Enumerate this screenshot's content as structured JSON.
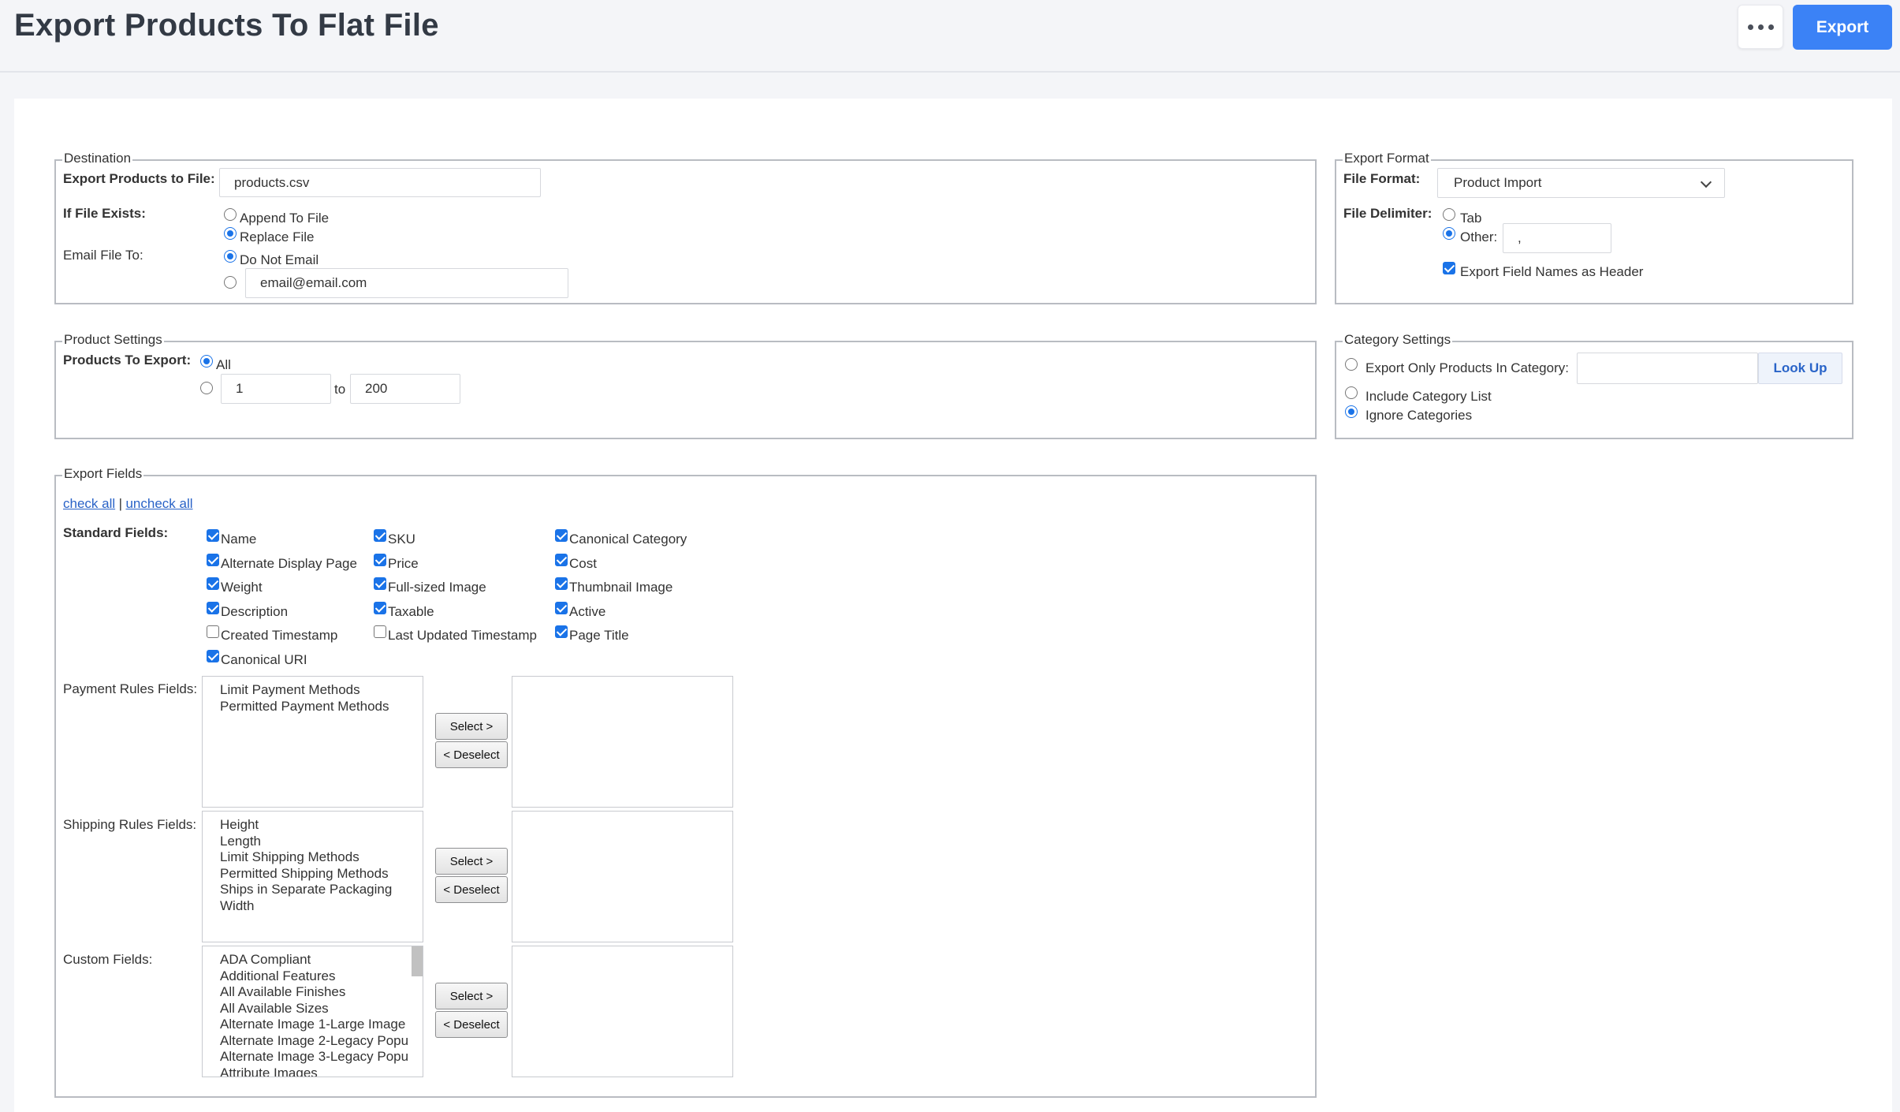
{
  "header": {
    "title": "Export Products To Flat File",
    "export_label": "Export",
    "more_icon": "more-horizontal-icon"
  },
  "destination": {
    "legend": "Destination",
    "file_label": "Export Products to File:",
    "file_value": "products.csv",
    "if_exists_label": "If File Exists:",
    "append_label": "Append To File",
    "replace_label": "Replace File",
    "if_exists_selected": "Replace File",
    "email_label": "Email File To:",
    "no_email_label": "Do Not Email",
    "email_selected": "Do Not Email",
    "email_value": "email@email.com"
  },
  "export_format": {
    "legend": "Export Format",
    "file_format_label": "File Format:",
    "file_format_value": "Product Import",
    "delimiter_label": "File Delimiter:",
    "tab_label": "Tab",
    "other_label": "Other:",
    "delimiter_selected": "Other:",
    "other_value": ",",
    "header_label": "Export Field Names as Header",
    "header_checked": true
  },
  "product_settings": {
    "legend": "Product Settings",
    "products_label": "Products To Export:",
    "all_label": "All",
    "selected": "All",
    "range_from": "1",
    "range_to_label": "to",
    "range_to": "200"
  },
  "category_settings": {
    "legend": "Category Settings",
    "only_in_category_label": "Export Only Products In Category:",
    "category_value": "",
    "lookup_label": "Look Up",
    "include_list_label": "Include Category List",
    "ignore_label": "Ignore Categories",
    "selected": "Ignore Categories"
  },
  "export_fields": {
    "legend": "Export Fields",
    "check_all": "check all",
    "separator": "|",
    "uncheck_all": "uncheck all",
    "standard_label": "Standard Fields:",
    "standard_fields": [
      {
        "label": "Name",
        "checked": true
      },
      {
        "label": "SKU",
        "checked": true
      },
      {
        "label": "Canonical Category",
        "checked": true
      },
      {
        "label": "Alternate Display Page",
        "checked": true
      },
      {
        "label": "Price",
        "checked": true
      },
      {
        "label": "Cost",
        "checked": true
      },
      {
        "label": "Weight",
        "checked": true
      },
      {
        "label": "Full-sized Image",
        "checked": true
      },
      {
        "label": "Thumbnail Image",
        "checked": true
      },
      {
        "label": "Description",
        "checked": true
      },
      {
        "label": "Taxable",
        "checked": true
      },
      {
        "label": "Active",
        "checked": true
      },
      {
        "label": "Created Timestamp",
        "checked": false
      },
      {
        "label": "Last Updated Timestamp",
        "checked": false
      },
      {
        "label": "Page Title",
        "checked": true
      },
      {
        "label": "Canonical URI",
        "checked": true
      }
    ],
    "payment_label": "Payment Rules Fields:",
    "payment_options": [
      "Limit Payment Methods",
      "Permitted Payment Methods"
    ],
    "shipping_label": "Shipping Rules Fields:",
    "shipping_options": [
      "Height",
      "Length",
      "Limit Shipping Methods",
      "Permitted Shipping Methods",
      "Ships in Separate Packaging",
      "Width"
    ],
    "custom_label": "Custom Fields:",
    "custom_options": [
      "ADA Compliant",
      "Additional Features",
      "All Available Finishes",
      "All Available Sizes",
      "Alternate Image 1-Large Image",
      "Alternate Image 2-Legacy Popu",
      "Alternate Image 3-Legacy Popu",
      "Attribute Images"
    ],
    "select_label": "Select >",
    "deselect_label": "< Deselect"
  }
}
